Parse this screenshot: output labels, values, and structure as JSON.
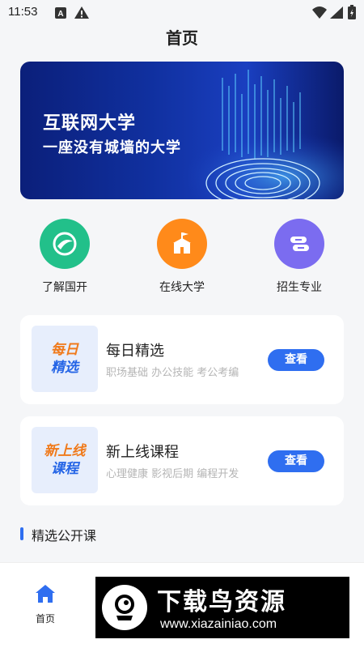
{
  "status_bar": {
    "time": "11:53"
  },
  "page_title": "首页",
  "banner": {
    "line1": "互联网大学",
    "line2": "一座没有城墙的大学"
  },
  "entries": [
    {
      "label": "了解国开",
      "icon": "leaf-globe-icon",
      "color": "#22c08a"
    },
    {
      "label": "在线大学",
      "icon": "school-building-icon",
      "color": "#ff8a1a"
    },
    {
      "label": "招生专业",
      "icon": "books-icon",
      "color": "#7b6cf0"
    }
  ],
  "cards": [
    {
      "thumb_line1": "每日",
      "thumb_line2": "精选",
      "title": "每日精选",
      "subtitle": "职场基础 办公技能 考公考编",
      "button": "查看"
    },
    {
      "thumb_line1": "新上线",
      "thumb_line2": "课程",
      "title": "新上线课程",
      "subtitle": "心理健康 影视后期 编程开发",
      "button": "查看"
    }
  ],
  "section": {
    "title": "精选公开课"
  },
  "tab_bar": {
    "home_label": "首页"
  },
  "watermark": {
    "title": "下载鸟资源",
    "url": "www.xiazainiao.com"
  },
  "colors": {
    "accent": "#2f6ef0",
    "thumb_orange": "#f07a1b",
    "thumb_blue": "#2565e6"
  }
}
